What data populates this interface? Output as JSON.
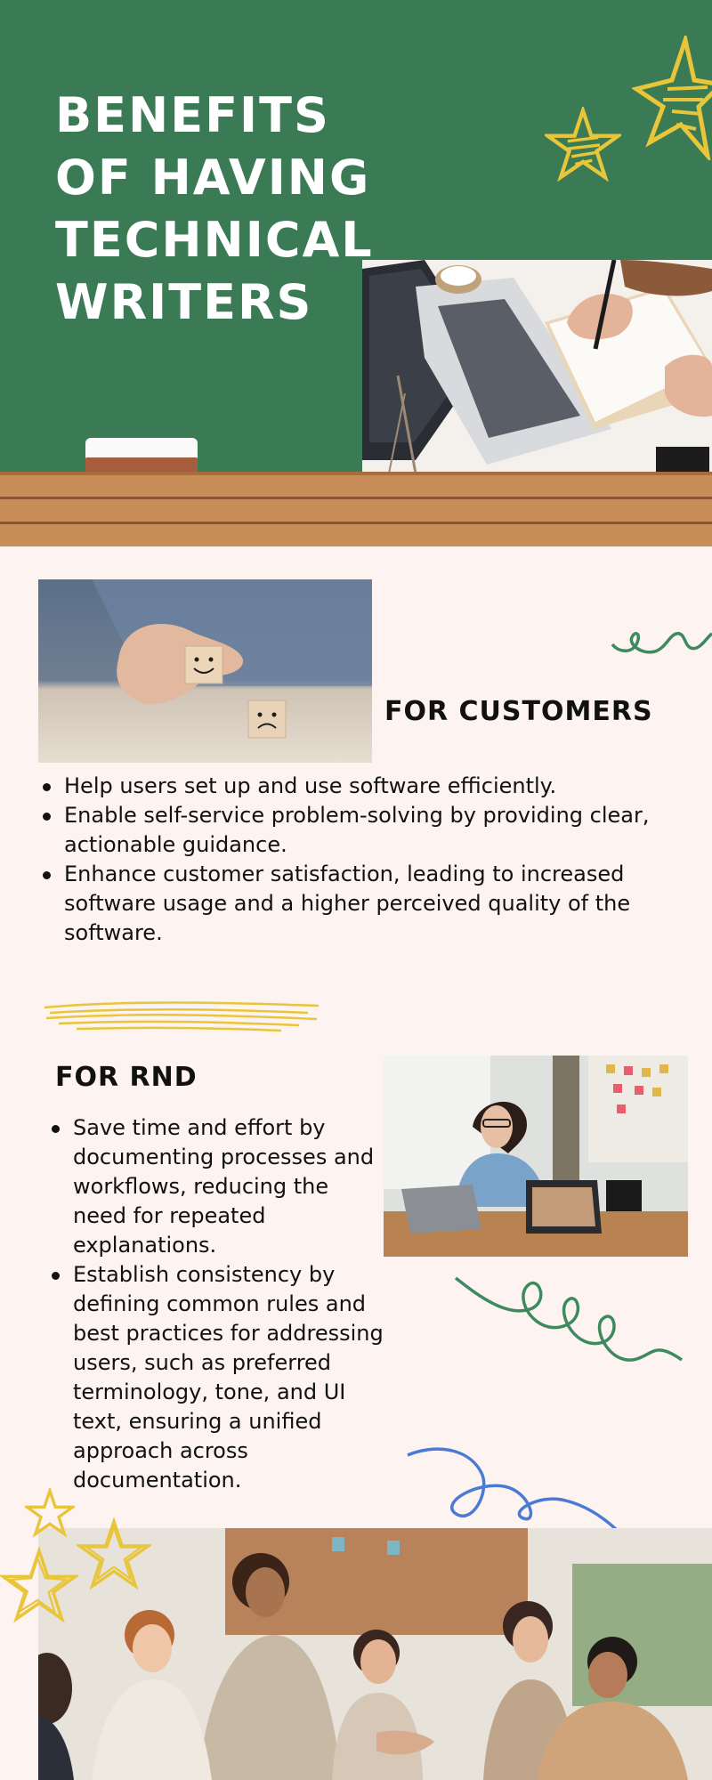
{
  "hero": {
    "title": "BENEFITS OF HAVING TECHNICAL WRITERS"
  },
  "customers": {
    "heading": "FOR CUSTOMERS",
    "items": [
      "Help users set up and use software efficiently.",
      "Enable self-service problem-solving by providing clear, actionable guidance.",
      "Enhance customer satisfaction, leading to increased software usage and a higher perceived quality of the software."
    ]
  },
  "rnd": {
    "heading": "FOR RND",
    "items": [
      "Save time and effort by documenting processes and workflows, reducing the need for repeated explanations.",
      "Establish consistency by defining common rules and best practices for addressing users, such as preferred terminology, tone, and UI text, ensuring a unified approach across documentation."
    ]
  },
  "colors": {
    "chalkboard": "#3a7a55",
    "ledge": "#c98d57",
    "background": "#fdf3f0",
    "star_yellow": "#e9c53a",
    "squiggle_green": "#3d8a5f",
    "squiggle_blue": "#4a7ad6"
  }
}
